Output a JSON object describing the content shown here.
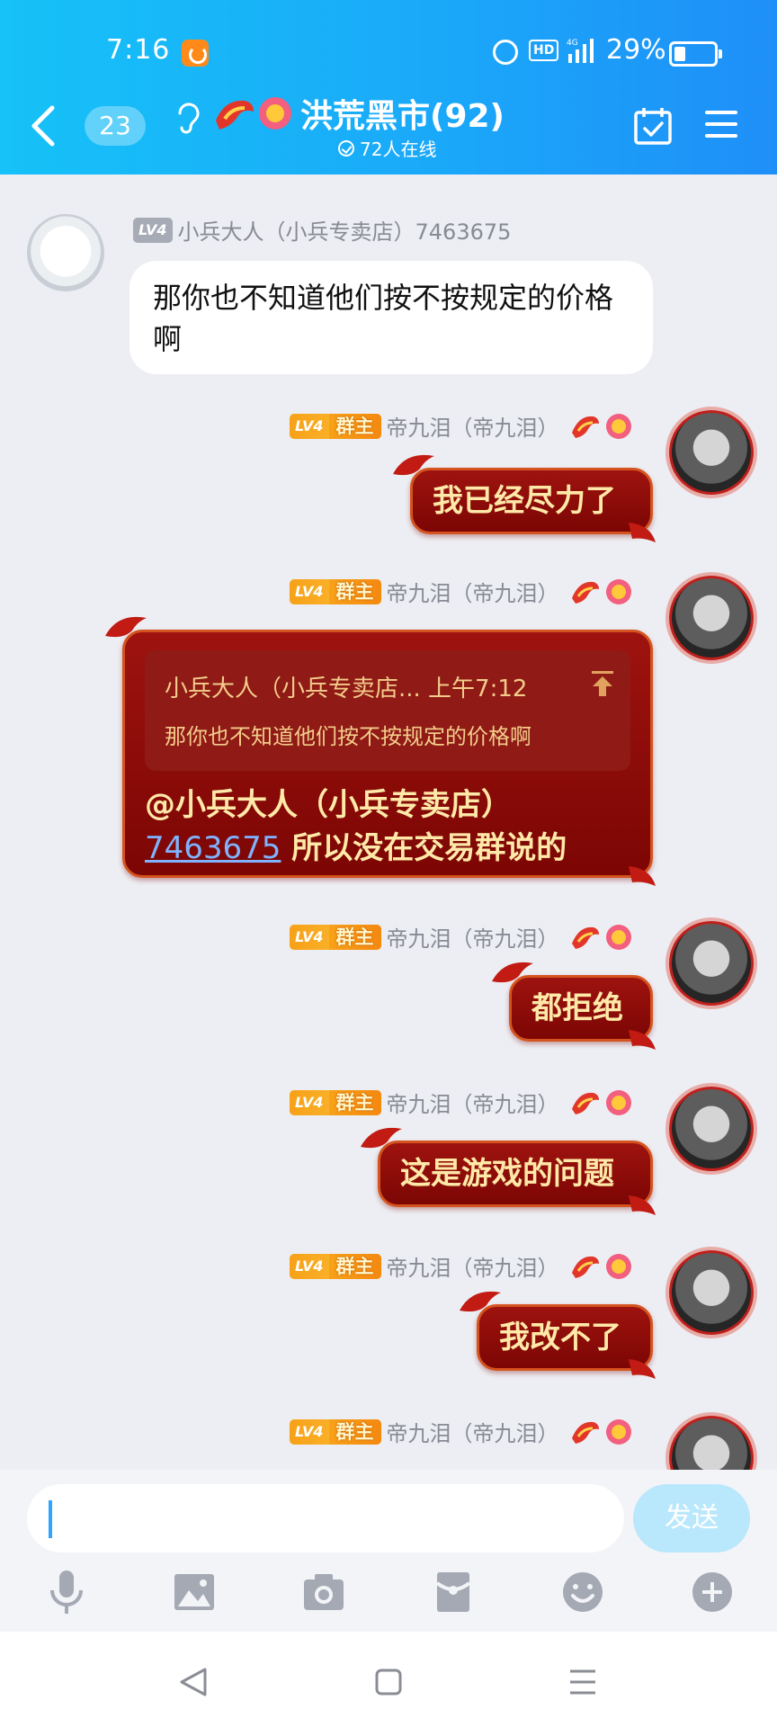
{
  "status_bar": {
    "time": "7:16",
    "hd": "HD",
    "battery": "29%"
  },
  "header": {
    "unread_count": "23",
    "title": "洪荒黑市(92)",
    "online": "72人在线"
  },
  "messages": [
    {
      "level": "LV4",
      "sender": "小兵大人（小兵专卖店）7463675",
      "text": "那你也不知道他们按不按规定的价格啊"
    },
    {
      "level": "LV4",
      "role": "群主",
      "sender": "帝九泪（帝九泪）",
      "text": "我已经尽力了"
    },
    {
      "level": "LV4",
      "role": "群主",
      "sender": "帝九泪（帝九泪）",
      "quote_header": "小兵大人（小兵专卖店... 上午7:12",
      "quote_text": "那你也不知道他们按不按规定的价格啊",
      "mention": "@小兵大人（小兵专卖店）",
      "mention_id": "7463675",
      "text": " 所以没在交易群说的"
    },
    {
      "level": "LV4",
      "role": "群主",
      "sender": "帝九泪（帝九泪）",
      "text": "都拒绝"
    },
    {
      "level": "LV4",
      "role": "群主",
      "sender": "帝九泪（帝九泪）",
      "text": "这是游戏的问题"
    },
    {
      "level": "LV4",
      "role": "群主",
      "sender": "帝九泪（帝九泪）",
      "text": "我改不了"
    },
    {
      "level": "LV4",
      "role": "群主",
      "sender": "帝九泪（帝九泪）"
    }
  ],
  "input": {
    "placeholder": "",
    "send_label": "发送"
  },
  "toolbar_icons": [
    "microphone-icon",
    "image-icon",
    "camera-icon",
    "red-packet-icon",
    "emoji-icon",
    "plus-icon"
  ],
  "nav_icons": [
    "back-triangle-icon",
    "home-square-icon",
    "recents-menu-icon"
  ],
  "colors": {
    "header": "#1aa9f9",
    "bubble_red": "#8b0c09",
    "bubble_text": "#ffe9a8",
    "send_button": "#b9e7fb"
  }
}
